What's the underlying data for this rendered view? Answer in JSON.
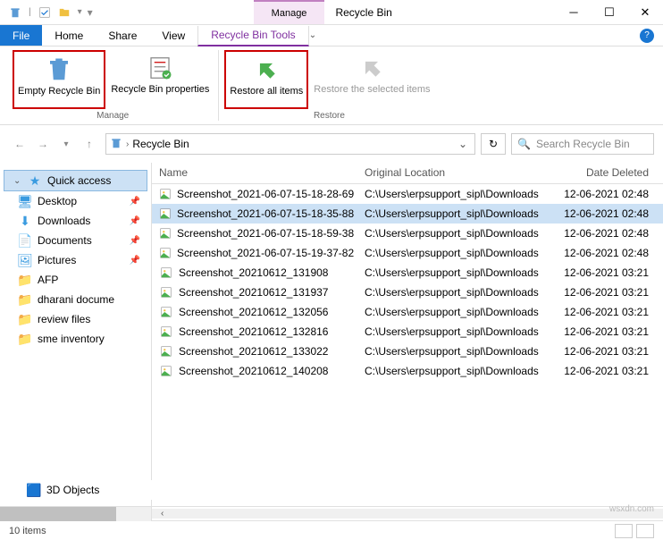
{
  "title_bar": {
    "contextual": "Manage",
    "title": "Recycle Bin"
  },
  "tabs": {
    "file": "File",
    "home": "Home",
    "share": "Share",
    "view": "View",
    "tools": "Recycle Bin Tools"
  },
  "ribbon": {
    "empty": "Empty Recycle Bin",
    "properties": "Recycle Bin properties",
    "restore_all": "Restore all items",
    "restore_selected": "Restore the selected items",
    "group_manage": "Manage",
    "group_restore": "Restore"
  },
  "address": {
    "location": "Recycle Bin",
    "search_placeholder": "Search Recycle Bin"
  },
  "columns": {
    "name": "Name",
    "location": "Original Location",
    "date": "Date Deleted"
  },
  "nav": {
    "quick": "Quick access",
    "desktop": "Desktop",
    "downloads": "Downloads",
    "documents": "Documents",
    "pictures": "Pictures",
    "afp": "AFP",
    "dharani": "dharani docume",
    "review": "review files",
    "sme": "sme inventory",
    "objects3d": "3D Objects"
  },
  "files": [
    {
      "name": "Screenshot_2021-06-07-15-18-28-69",
      "loc": "C:\\Users\\erpsupport_sipl\\Downloads",
      "date": "12-06-2021 02:48"
    },
    {
      "name": "Screenshot_2021-06-07-15-18-35-88",
      "loc": "C:\\Users\\erpsupport_sipl\\Downloads",
      "date": "12-06-2021 02:48"
    },
    {
      "name": "Screenshot_2021-06-07-15-18-59-38",
      "loc": "C:\\Users\\erpsupport_sipl\\Downloads",
      "date": "12-06-2021 02:48"
    },
    {
      "name": "Screenshot_2021-06-07-15-19-37-82",
      "loc": "C:\\Users\\erpsupport_sipl\\Downloads",
      "date": "12-06-2021 02:48"
    },
    {
      "name": "Screenshot_20210612_131908",
      "loc": "C:\\Users\\erpsupport_sipl\\Downloads",
      "date": "12-06-2021 03:21"
    },
    {
      "name": "Screenshot_20210612_131937",
      "loc": "C:\\Users\\erpsupport_sipl\\Downloads",
      "date": "12-06-2021 03:21"
    },
    {
      "name": "Screenshot_20210612_132056",
      "loc": "C:\\Users\\erpsupport_sipl\\Downloads",
      "date": "12-06-2021 03:21"
    },
    {
      "name": "Screenshot_20210612_132816",
      "loc": "C:\\Users\\erpsupport_sipl\\Downloads",
      "date": "12-06-2021 03:21"
    },
    {
      "name": "Screenshot_20210612_133022",
      "loc": "C:\\Users\\erpsupport_sipl\\Downloads",
      "date": "12-06-2021 03:21"
    },
    {
      "name": "Screenshot_20210612_140208",
      "loc": "C:\\Users\\erpsupport_sipl\\Downloads",
      "date": "12-06-2021 03:21"
    }
  ],
  "status": {
    "count": "10 items",
    "watermark": "wsxdn.com"
  }
}
